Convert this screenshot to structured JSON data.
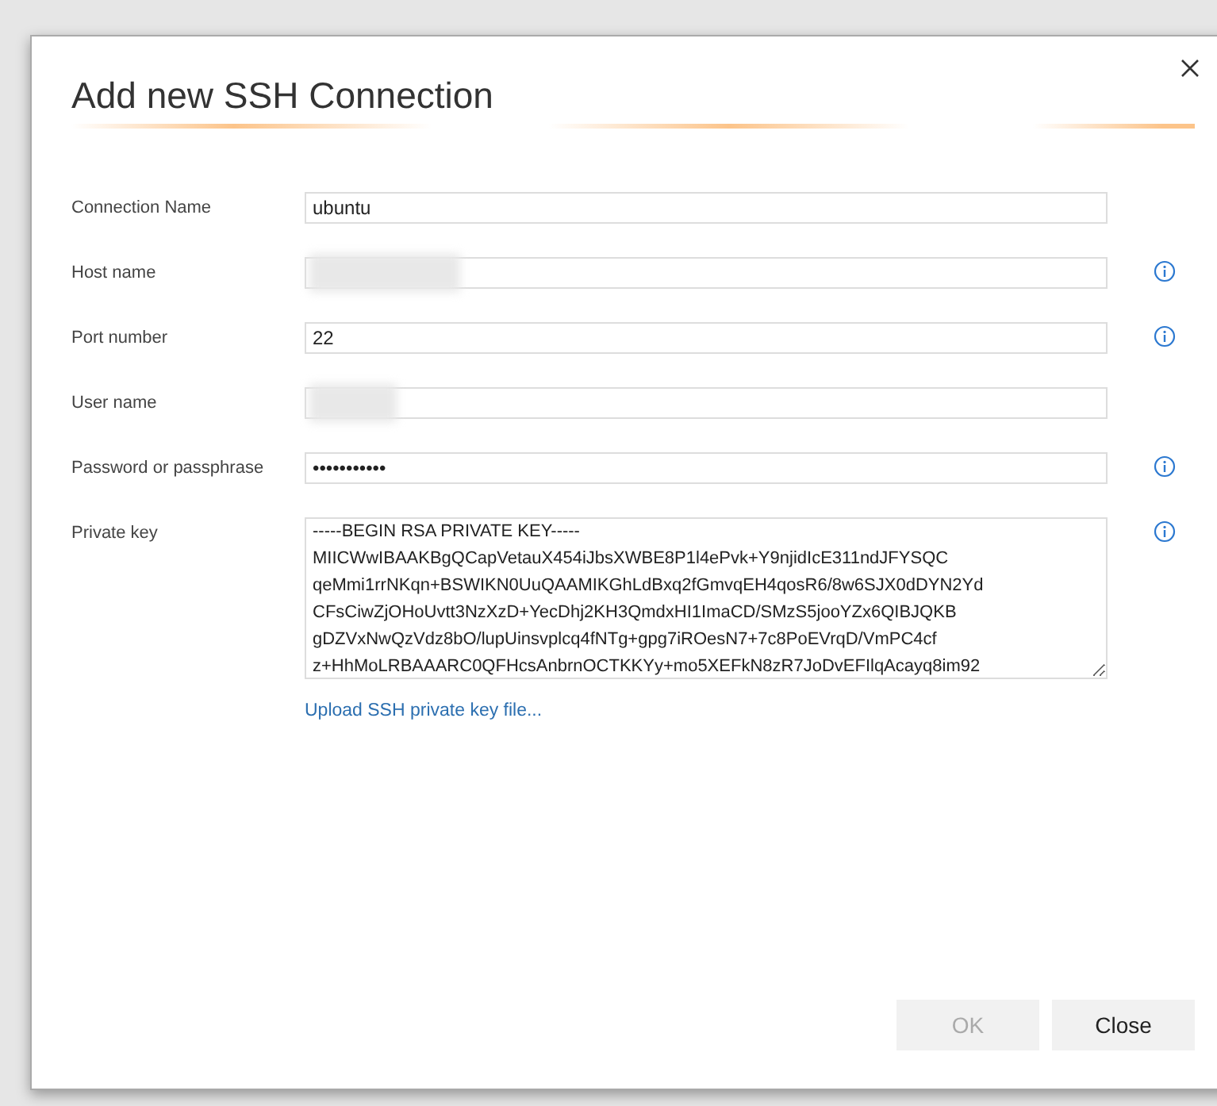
{
  "dialog": {
    "title": "Add new SSH Connection"
  },
  "fields": [
    {
      "label": "Connection Name",
      "kind": "text",
      "value": "ubuntu",
      "redacted": false,
      "info": false
    },
    {
      "label": "Host name",
      "kind": "text",
      "redacted": true,
      "info": true
    },
    {
      "label": "Port number",
      "kind": "text",
      "value": "22",
      "redacted": false,
      "info": true
    },
    {
      "label": "User name",
      "kind": "text",
      "redacted": true,
      "info": false
    },
    {
      "label": "Password or passphrase",
      "kind": "text",
      "value": "•••••••••••",
      "redacted": false,
      "info": true
    },
    {
      "label": "Private key",
      "kind": "multiline",
      "redacted": false,
      "info": true,
      "lines": [
        "-----BEGIN RSA PRIVATE KEY-----",
        "MIICWwIBAAKBgQCapVetauX454iJbsXWBE8P1l4ePvk+Y9njidIcE311ndJFYSQC",
        "qeMmi1rrNKqn+BSWIKN0UuQAAMIKGhLdBxq2fGmvqEH4qosR6/8w6SJX0dDYN2Yd",
        "CFsCiwZjOHoUvtt3NzXzD+YecDhj2KH3QmdxHI1ImaCD/SMzS5jooYZx6QIBJQKB",
        "gDZVxNwQzVdz8bO/lupUinsvplcq4fNTg+gpg7iROesN7+7c8PoEVrqD/VmPC4cf",
        "z+HhMoLRBAAARC0QFHcsAnbrnOCTKKYy+mo5XEFkN8zR7JoDvEFIlqAcayq8im92"
      ]
    }
  ],
  "upload_link": "Upload SSH private key file...",
  "buttons": [
    {
      "label": "OK",
      "disabled": true
    },
    {
      "label": "Close",
      "disabled": false
    }
  ]
}
